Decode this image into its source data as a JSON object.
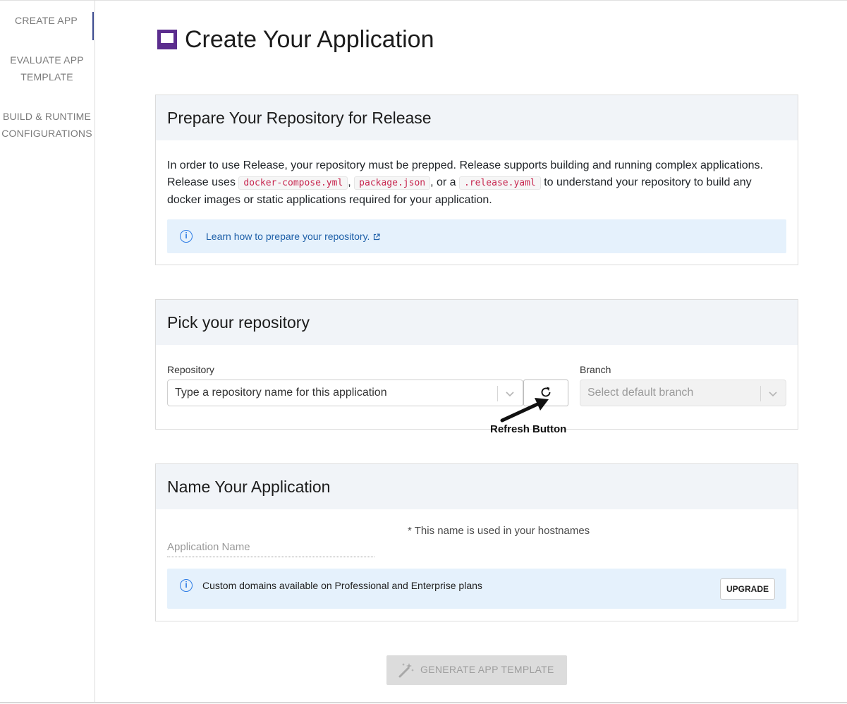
{
  "sidebar": {
    "items": [
      {
        "line1": "CREATE APP",
        "line2": ""
      },
      {
        "line1": "EVALUATE APP",
        "line2": "TEMPLATE"
      },
      {
        "line1": "BUILD & RUNTIME",
        "line2": "CONFIGURATIONS"
      }
    ],
    "active_index": 0
  },
  "page": {
    "title": "Create Your Application",
    "brand_color": "#5b2d8e"
  },
  "prepare": {
    "heading": "Prepare Your Repository for Release",
    "text_1": "In order to use Release, your repository must be prepped. Release supports building and running complex applications. Release uses ",
    "code_1": "docker-compose.yml",
    "sep_1": ", ",
    "code_2": "package.json",
    "sep_2": ", or a ",
    "code_3": ".release.yaml",
    "text_2": " to understand your repository to build any docker images or static applications required for your application.",
    "link_text": "Learn how to prepare your repository.",
    "link_icon": "external-link-icon"
  },
  "pick": {
    "heading": "Pick your repository",
    "repo_label": "Repository",
    "repo_placeholder": "Type a repository name for this application",
    "branch_label": "Branch",
    "branch_placeholder": "Select default branch",
    "refresh_icon": "refresh-icon",
    "annotation": "Refresh Button"
  },
  "name": {
    "heading": "Name Your Application",
    "input_placeholder": "Application Name",
    "hostname_note": "* This name is used in your hostnames",
    "domains_note": "Custom domains available on Professional and Enterprise plans",
    "upgrade_label": "UPGRADE"
  },
  "footer": {
    "generate_label": "GENERATE APP TEMPLATE",
    "generate_icon": "magic-wand-icon"
  },
  "colors": {
    "info_bg": "#e5f1fc",
    "info_icon": "#2c7be5",
    "code_text": "#c7254e",
    "active_nav": "#3c4a8f"
  }
}
